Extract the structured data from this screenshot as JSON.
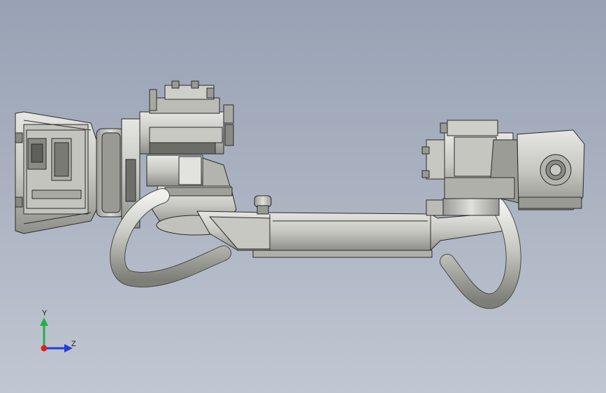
{
  "viewport": {
    "background_top": "#98a2b4",
    "background_bottom": "#c1c7d2"
  },
  "model": {
    "part_color_light": "#d4d4d0",
    "part_color_mid": "#b9b9b4",
    "part_color_dark": "#7d7d78",
    "edge_color": "#2a2a2a"
  },
  "triad": {
    "y_label": "Y",
    "z_label": "Z",
    "y_color": "#22b14c",
    "z_color": "#1f3fd6",
    "x_color": "#e02020"
  }
}
